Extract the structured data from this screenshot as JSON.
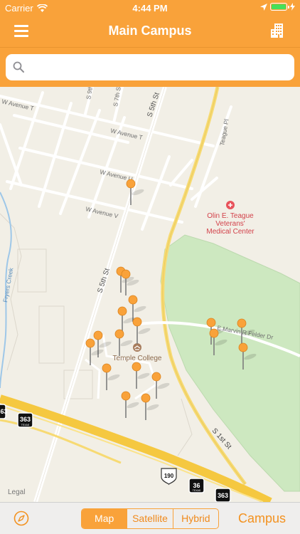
{
  "status": {
    "carrier": "Carrier",
    "time": "4:44 PM"
  },
  "nav": {
    "title": "Main Campus",
    "menu_icon": "hamburger-icon",
    "right_icon": "building-icon"
  },
  "search": {
    "placeholder": "",
    "value": ""
  },
  "map": {
    "streets": [
      "S 9th",
      "S 7th St",
      "S 5th St",
      "W Avenue T",
      "W Avenue T",
      "W Avenue U",
      "W Avenue V",
      "Teague Pl",
      "S 5th St",
      "E Marvin R Felder Dr",
      "S 1st St",
      "Fryers Creek"
    ],
    "poi_hospital": [
      "Olin E. Teague",
      "Veterans'",
      "Medical Center"
    ],
    "poi_college": "Temple College",
    "shields": [
      "363",
      "363",
      "36",
      "190",
      "363"
    ],
    "shield_sub": "TEXAS",
    "legal": "Legal"
  },
  "bottom": {
    "tabs": [
      "Map",
      "Satellite",
      "Hybrid"
    ],
    "selected": "Map",
    "campus": "Campus"
  }
}
